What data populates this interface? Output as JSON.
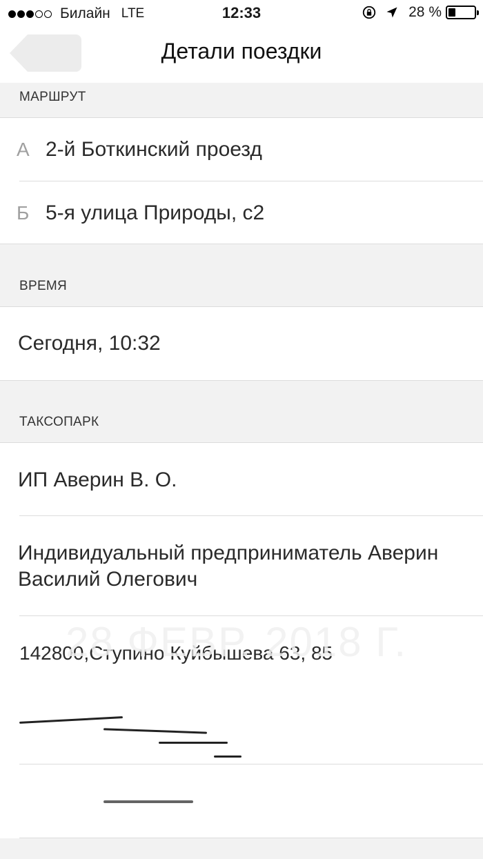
{
  "status_bar": {
    "carrier": "Билайн",
    "network": "LTE",
    "time": "12:33",
    "battery": "28 %",
    "battery_level": 0.28,
    "signal_bars_filled": 3,
    "signal_bars_total": 5
  },
  "nav": {
    "title": "Детали поездки"
  },
  "sections": {
    "route": {
      "header": "МАРШРУТ",
      "points": [
        {
          "letter": "А",
          "address": "2-й Боткинский проезд"
        },
        {
          "letter": "Б",
          "address": "5-я улица Природы, с2"
        }
      ]
    },
    "time": {
      "header": "ВРЕМЯ",
      "value": "Сегодня, 10:32"
    },
    "taxi_park": {
      "header": "ТАКСОПАРК",
      "name": "ИП Аверин В. О.",
      "full_name_line1": "Индивидуальный предприниматель Аверин",
      "full_name_line2": "Василий Олегович",
      "address": "142800,Ступино Куйбышева 63, 85"
    }
  },
  "watermark": "28 ФЕВР. 2018 Г."
}
